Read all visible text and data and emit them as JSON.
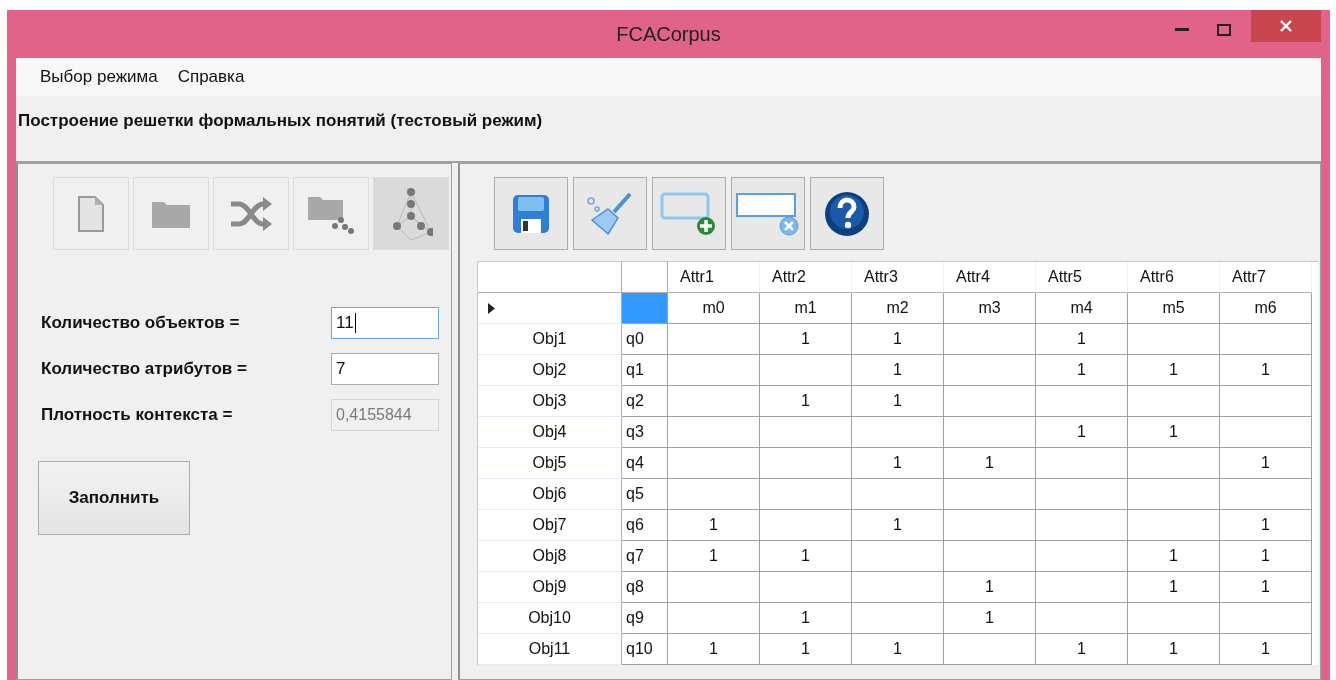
{
  "window": {
    "title": "FCACorpus",
    "controls": [
      {
        "kind": "minimize"
      },
      {
        "kind": "maximize"
      },
      {
        "kind": "close"
      }
    ]
  },
  "menu": [
    {
      "label": "Выбор режима"
    },
    {
      "label": "Справка"
    }
  ],
  "heading": "Построение решетки формальных понятий (тестовый режим)",
  "left_toolbar": [
    {
      "kind": "file",
      "selected": false
    },
    {
      "kind": "folder",
      "selected": false
    },
    {
      "kind": "shuffle",
      "selected": false
    },
    {
      "kind": "folder-graph",
      "selected": false
    },
    {
      "kind": "lattice",
      "selected": true
    }
  ],
  "fields": [
    {
      "label": "Количество объектов =",
      "value": "11",
      "focused": true,
      "disabled": false
    },
    {
      "label": "Количество атрибутов =",
      "value": "7",
      "focused": false,
      "disabled": false
    },
    {
      "label": "Плотность контекста =",
      "value": "0,4155844",
      "focused": false,
      "disabled": true
    }
  ],
  "fill_button": "Заполнить",
  "right_toolbar": [
    {
      "kind": "save"
    },
    {
      "kind": "broom"
    },
    {
      "kind": "add-row"
    },
    {
      "kind": "remove-row"
    },
    {
      "kind": "help"
    }
  ],
  "table": {
    "columns": [
      {
        "label": "Attr1"
      },
      {
        "label": "Attr2"
      },
      {
        "label": "Attr3"
      },
      {
        "label": "Attr4"
      },
      {
        "label": "Attr5"
      },
      {
        "label": "Attr6"
      },
      {
        "label": "Attr7"
      }
    ],
    "rows": [
      {
        "header": null,
        "key": null,
        "current": true,
        "key_selected": true,
        "cells": [
          "m0",
          "m1",
          "m2",
          "m3",
          "m4",
          "m5",
          "m6"
        ]
      },
      {
        "header": "Obj1",
        "key": "q0",
        "current": false,
        "key_selected": false,
        "cells": [
          null,
          "1",
          "1",
          null,
          "1",
          null,
          null
        ]
      },
      {
        "header": "Obj2",
        "key": "q1",
        "current": false,
        "key_selected": false,
        "cells": [
          null,
          null,
          "1",
          null,
          "1",
          "1",
          "1"
        ]
      },
      {
        "header": "Obj3",
        "key": "q2",
        "current": false,
        "key_selected": false,
        "cells": [
          null,
          "1",
          "1",
          null,
          null,
          null,
          null
        ]
      },
      {
        "header": "Obj4",
        "key": "q3",
        "current": false,
        "key_selected": false,
        "cells": [
          null,
          null,
          null,
          null,
          "1",
          "1",
          null
        ]
      },
      {
        "header": "Obj5",
        "key": "q4",
        "current": false,
        "key_selected": false,
        "cells": [
          null,
          null,
          "1",
          "1",
          null,
          null,
          "1"
        ]
      },
      {
        "header": "Obj6",
        "key": "q5",
        "current": false,
        "key_selected": false,
        "cells": [
          null,
          null,
          null,
          null,
          null,
          null,
          null
        ]
      },
      {
        "header": "Obj7",
        "key": "q6",
        "current": false,
        "key_selected": false,
        "cells": [
          "1",
          null,
          "1",
          null,
          null,
          null,
          "1"
        ]
      },
      {
        "header": "Obj8",
        "key": "q7",
        "current": false,
        "key_selected": false,
        "cells": [
          "1",
          "1",
          null,
          null,
          null,
          "1",
          "1"
        ]
      },
      {
        "header": "Obj9",
        "key": "q8",
        "current": false,
        "key_selected": false,
        "cells": [
          null,
          null,
          null,
          "1",
          null,
          "1",
          "1"
        ]
      },
      {
        "header": "Obj10",
        "key": "q9",
        "current": false,
        "key_selected": false,
        "cells": [
          null,
          "1",
          null,
          "1",
          null,
          null,
          null
        ]
      },
      {
        "header": "Obj11",
        "key": "q10",
        "current": false,
        "key_selected": false,
        "cells": [
          "1",
          "1",
          "1",
          null,
          "1",
          "1",
          "1"
        ]
      }
    ]
  }
}
